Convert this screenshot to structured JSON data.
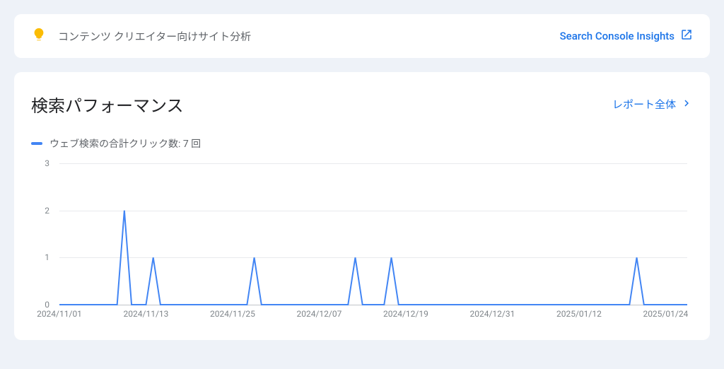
{
  "banner": {
    "text": "コンテンツ クリエイター向けサイト分析",
    "link_label": "Search Console Insights"
  },
  "card": {
    "title": "検索パフォーマンス",
    "full_report_label": "レポート全体"
  },
  "legend": {
    "label": "ウェブ検索の合計クリック数: 7 回"
  },
  "chart_data": {
    "type": "line",
    "title": "検索パフォーマンス",
    "xlabel": "",
    "ylabel": "",
    "ylim": [
      0,
      3
    ],
    "y_ticks": [
      0,
      1,
      2,
      3
    ],
    "x_tick_labels": [
      "2024/11/01",
      "2024/11/13",
      "2024/11/25",
      "2024/12/07",
      "2024/12/19",
      "2024/12/31",
      "2025/01/12",
      "2025/01/24"
    ],
    "series": [
      {
        "name": "ウェブ検索の合計クリック数",
        "x": [
          "2024/11/01",
          "2024/11/02",
          "2024/11/03",
          "2024/11/04",
          "2024/11/05",
          "2024/11/06",
          "2024/11/07",
          "2024/11/08",
          "2024/11/09",
          "2024/11/10",
          "2024/11/11",
          "2024/11/12",
          "2024/11/13",
          "2024/11/14",
          "2024/11/15",
          "2024/11/16",
          "2024/11/17",
          "2024/11/18",
          "2024/11/19",
          "2024/11/20",
          "2024/11/21",
          "2024/11/22",
          "2024/11/23",
          "2024/11/24",
          "2024/11/25",
          "2024/11/26",
          "2024/11/27",
          "2024/11/28",
          "2024/11/29",
          "2024/11/30",
          "2024/12/01",
          "2024/12/02",
          "2024/12/03",
          "2024/12/04",
          "2024/12/05",
          "2024/12/06",
          "2024/12/07",
          "2024/12/08",
          "2024/12/09",
          "2024/12/10",
          "2024/12/11",
          "2024/12/12",
          "2024/12/13",
          "2024/12/14",
          "2024/12/15",
          "2024/12/16",
          "2024/12/17",
          "2024/12/18",
          "2024/12/19",
          "2024/12/20",
          "2024/12/21",
          "2024/12/22",
          "2024/12/23",
          "2024/12/24",
          "2024/12/25",
          "2024/12/26",
          "2024/12/27",
          "2024/12/28",
          "2024/12/29",
          "2024/12/30",
          "2024/12/31",
          "2025/01/01",
          "2025/01/02",
          "2025/01/03",
          "2025/01/04",
          "2025/01/05",
          "2025/01/06",
          "2025/01/07",
          "2025/01/08",
          "2025/01/09",
          "2025/01/10",
          "2025/01/11",
          "2025/01/12",
          "2025/01/13",
          "2025/01/14",
          "2025/01/15",
          "2025/01/16",
          "2025/01/17",
          "2025/01/18",
          "2025/01/19",
          "2025/01/20",
          "2025/01/21",
          "2025/01/22",
          "2025/01/23",
          "2025/01/24",
          "2025/01/25",
          "2025/01/26",
          "2025/01/27"
        ],
        "values": [
          0,
          0,
          0,
          0,
          0,
          0,
          0,
          0,
          0,
          2,
          0,
          0,
          0,
          1,
          0,
          0,
          0,
          0,
          0,
          0,
          0,
          0,
          0,
          0,
          0,
          0,
          0,
          1,
          0,
          0,
          0,
          0,
          0,
          0,
          0,
          0,
          0,
          0,
          0,
          0,
          0,
          1,
          0,
          0,
          0,
          0,
          1,
          0,
          0,
          0,
          0,
          0,
          0,
          0,
          0,
          0,
          0,
          0,
          0,
          0,
          0,
          0,
          0,
          0,
          0,
          0,
          0,
          0,
          0,
          0,
          0,
          0,
          0,
          0,
          0,
          0,
          0,
          0,
          0,
          0,
          1,
          0,
          0,
          0,
          0,
          0,
          0,
          0
        ]
      }
    ]
  }
}
